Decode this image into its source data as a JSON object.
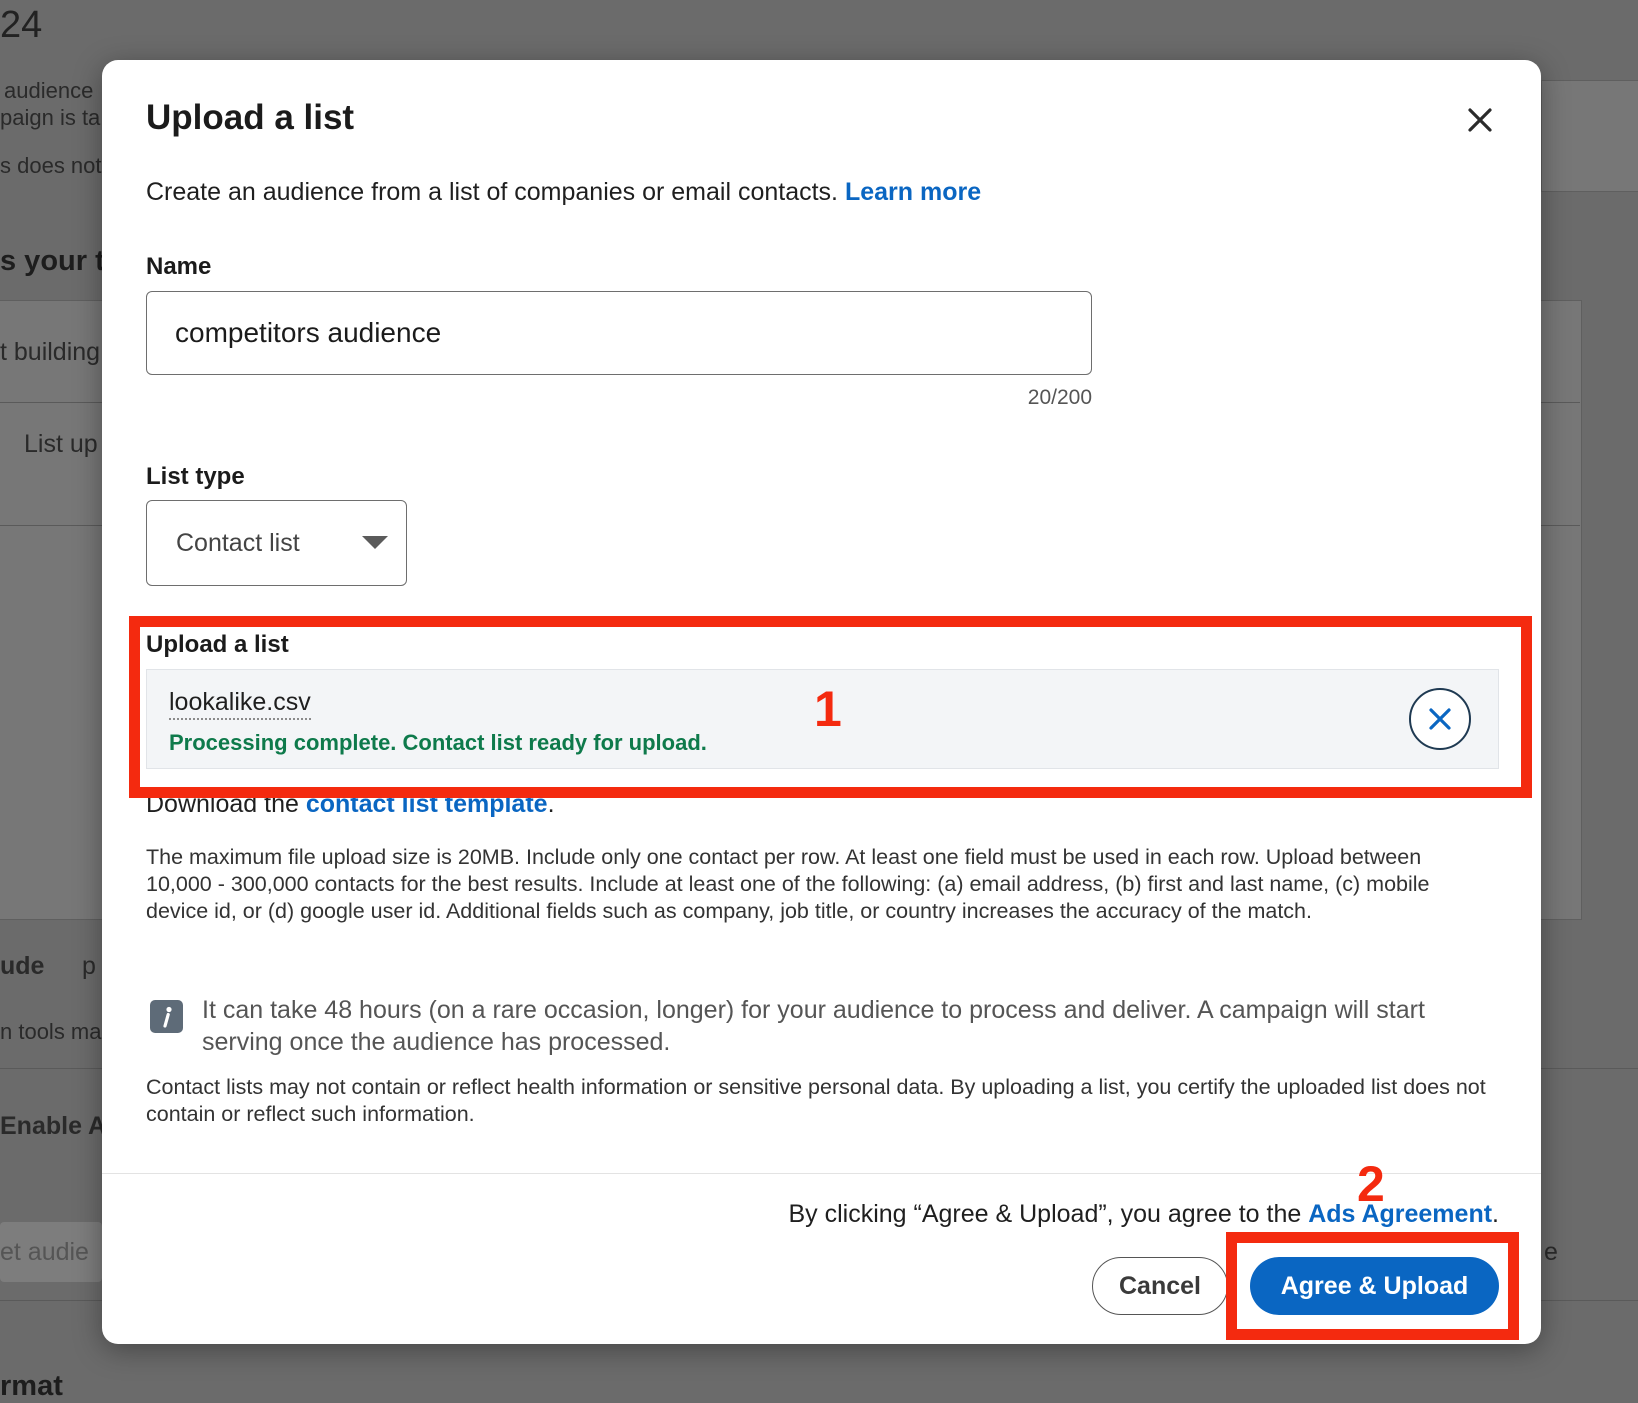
{
  "background": {
    "year_fragment": "24",
    "lines": [
      "audience",
      "paign is ta",
      "s does not",
      "s your t",
      "t building",
      "List up",
      "ude",
      "p",
      "n tools ma",
      "Enable Au",
      "et audie",
      "e",
      "rmat"
    ]
  },
  "modal": {
    "title": "Upload a list",
    "close_label": "Close",
    "intro_text": "Create an audience from a list of companies or email contacts. ",
    "learn_more": "Learn more",
    "name_label": "Name",
    "name_value": "competitors audience",
    "name_counter": "20/200",
    "list_type_label": "List type",
    "list_type_value": "Contact list",
    "upload_label": "Upload a list",
    "file_name": "lookalike.csv",
    "file_status": "Processing complete. Contact list ready for upload.",
    "download_prefix": "Download the ",
    "download_link": "contact list template",
    "download_suffix": ".",
    "rules_text": "The maximum file upload size is 20MB. Include only one contact per row. At least one field must be used in each row. Upload between 10,000 - 300,000 contacts for the best results. Include at least one of the following: (a) email address, (b) first and last name, (c) mobile device id, or (d) google user id. Additional fields such as company, job title, or country increases the accuracy of the match.",
    "info_text": "It can take 48 hours (on a rare occasion, longer) for your audience to process and deliver. A campaign will start serving once the audience has processed.",
    "privacy_text": "Contact lists may not contain or reflect health information or sensitive personal data. By uploading a list, you certify the uploaded list does not contain or reflect such information.",
    "agree_note_prefix": "By clicking “Agree & Upload”, you agree to the ",
    "agree_note_link": "Ads Agreement",
    "agree_note_suffix": ".",
    "cancel_label": "Cancel",
    "agree_label": "Agree & Upload"
  },
  "annotations": {
    "step_1": "1",
    "step_2": "2",
    "color": "#f42a0f"
  },
  "colors": {
    "accent": "#0a66c2",
    "success": "#0e7a4b",
    "overlay": "#6b6b6b"
  },
  "icons": {
    "close": "close-icon",
    "dropdown": "caret-down-icon",
    "remove_file": "remove-file-icon",
    "info": "info-icon"
  }
}
